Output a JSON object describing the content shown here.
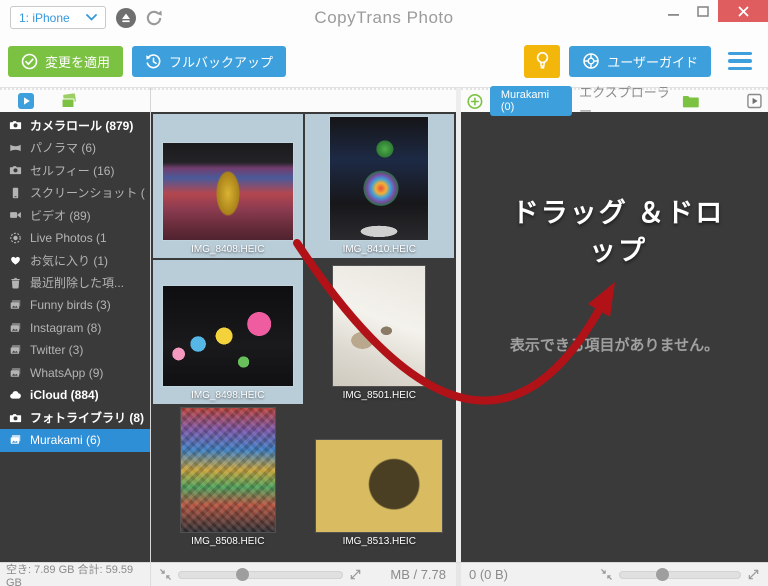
{
  "window": {
    "title": "CopyTrans Photo",
    "device_selector": "1: iPhone"
  },
  "toolbar": {
    "apply_label": "変更を適用",
    "backup_label": "フルバックアップ",
    "guide_label": "ユーザーガイド"
  },
  "sidebar": {
    "items": [
      {
        "label": "カメラロール (879)",
        "icon": "camera-icon"
      },
      {
        "label": "パノラマ (6)",
        "icon": "panorama-icon"
      },
      {
        "label": "セルフィー (16)",
        "icon": "camera-icon"
      },
      {
        "label": "スクリーンショット (",
        "icon": "phone-icon"
      },
      {
        "label": "ビデオ (89)",
        "icon": "video-icon"
      },
      {
        "label": "Live Photos (1",
        "icon": "live-photo-icon"
      },
      {
        "label": "お気に入り (1)",
        "icon": "heart-icon"
      },
      {
        "label": "最近削除した項...",
        "icon": "trash-icon"
      },
      {
        "label": "Funny birds (3)",
        "icon": "album-icon"
      },
      {
        "label": "Instagram (8)",
        "icon": "album-icon"
      },
      {
        "label": "Twitter (3)",
        "icon": "album-icon"
      },
      {
        "label": "WhatsApp (9)",
        "icon": "album-icon"
      },
      {
        "label": "iCloud (884)",
        "icon": "cloud-icon"
      },
      {
        "label": "フォトライブラリ (8)",
        "icon": "camera-icon"
      },
      {
        "label": "Murakami (6)",
        "icon": "album-icon"
      }
    ],
    "disk_status": "空き: 7.89 GB 合計: 59.59 GB"
  },
  "grid": {
    "photos": [
      {
        "filename": "IMG_8408.HEIC",
        "selected": true
      },
      {
        "filename": "IMG_8410.HEIC",
        "selected": true
      },
      {
        "filename": "IMG_8498.HEIC",
        "selected": true
      },
      {
        "filename": "IMG_8501.HEIC",
        "selected": false
      },
      {
        "filename": "IMG_8508.HEIC",
        "selected": false
      },
      {
        "filename": "IMG_8513.HEIC",
        "selected": false
      }
    ],
    "size_status": "MB / 7.78"
  },
  "right_panel": {
    "tab_label": "Murakami (0)",
    "explorer_label": "エクスプローラー",
    "drop_title": "ドラッグ ＆ドロップ",
    "empty_message": "表示できる項目がありません。",
    "selection_status": "0 (0 B)"
  },
  "colors": {
    "accent_blue": "#3da0dc",
    "accent_green": "#7cc242",
    "accent_yellow": "#f3b70c",
    "sidebar_selection": "#2e8ed6",
    "photo_selection": "#b9cdd9",
    "arrow_red": "#b01218",
    "close_red": "#e05d5f"
  }
}
